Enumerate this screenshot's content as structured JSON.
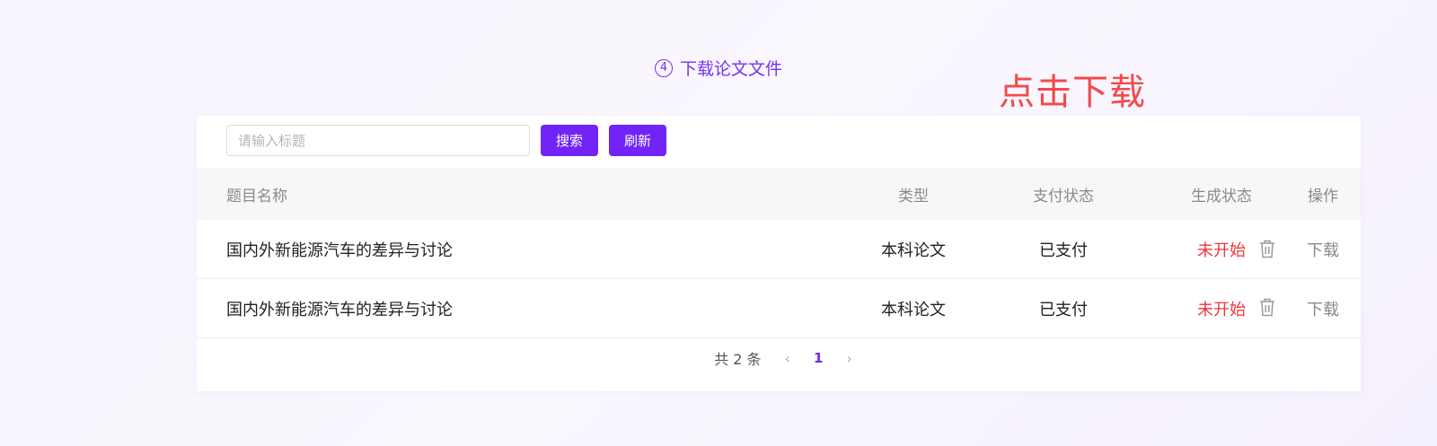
{
  "step": {
    "number": "4",
    "title": "下载论文文件"
  },
  "annotation": {
    "text": "点击下载"
  },
  "toolbar": {
    "search_placeholder": "请输入标题",
    "search_label": "搜索",
    "refresh_label": "刷新"
  },
  "table": {
    "columns": [
      "题目名称",
      "类型",
      "支付状态",
      "生成状态",
      "操作"
    ],
    "rows": [
      {
        "title": "国内外新能源汽车的差异与讨论",
        "type": "本科论文",
        "pay_status": "已支付",
        "gen_status": "未开始",
        "action": "下载"
      },
      {
        "title": "国内外新能源汽车的差异与讨论",
        "type": "本科论文",
        "pay_status": "已支付",
        "gen_status": "未开始",
        "action": "下载"
      }
    ]
  },
  "pagination": {
    "total": "共 2 条",
    "current": "1"
  },
  "colors": {
    "accent": "#7124f5",
    "status_red": "#f0353b",
    "annotation_red": "#f24a4a"
  }
}
